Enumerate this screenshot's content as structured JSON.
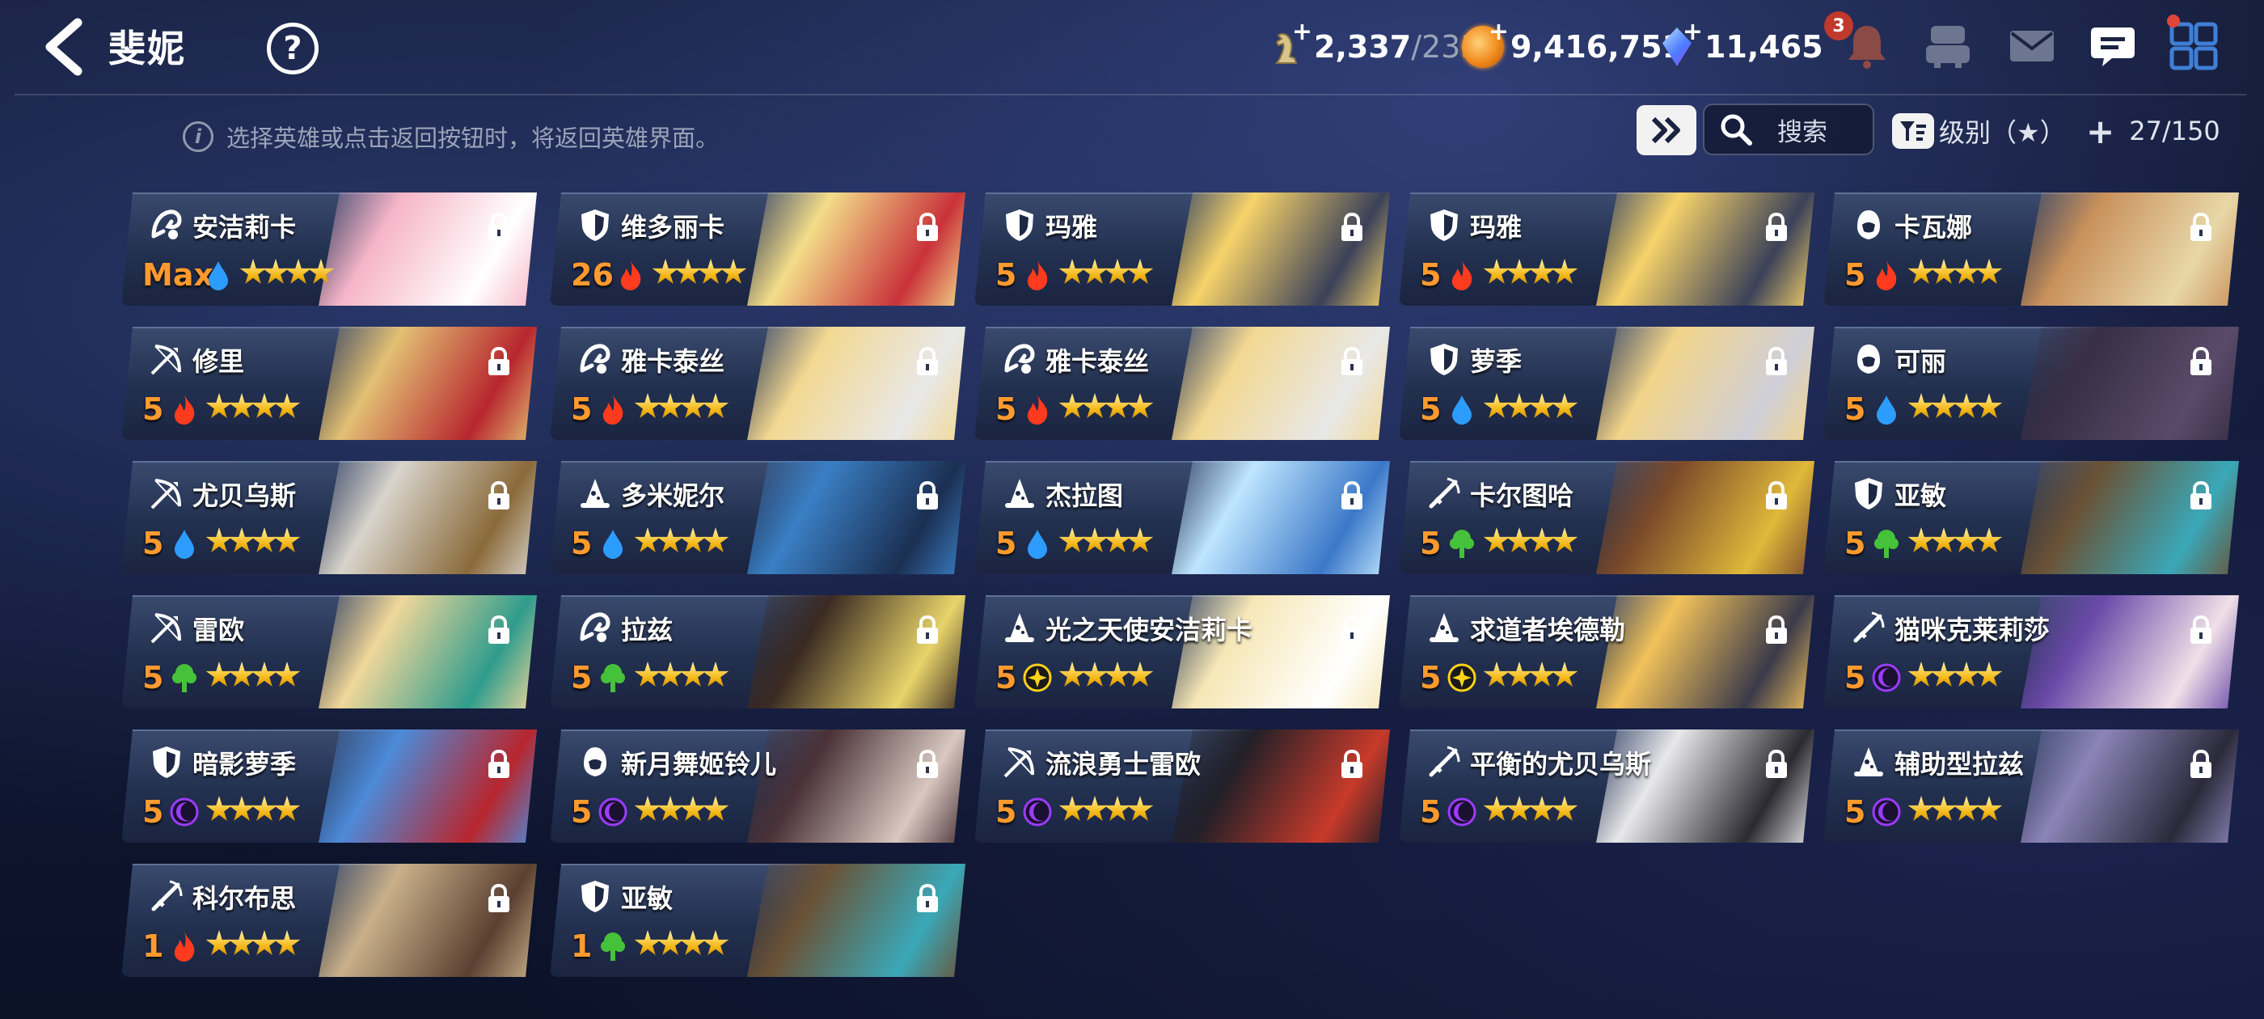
{
  "header": {
    "title": "斐妮",
    "resources": {
      "stamina": {
        "value": "2,337",
        "max": "/233"
      },
      "gold": {
        "value": "9,416,751"
      },
      "gems": {
        "value": "11,465"
      }
    },
    "bell_badge": "3"
  },
  "toolbar": {
    "hint": "选择英雄或点击返回按钮时，将返回英雄界面。",
    "search_label": "搜索",
    "sort_label": "级别（★）",
    "count": "27/150"
  },
  "colors": {
    "fire": "#ff3b1f",
    "water": "#2d9cff",
    "earth": "#46c23a",
    "light": "#ffd21a",
    "dark": "#9b3cff",
    "level": "#ff9a2e",
    "star": "#f5b818"
  },
  "heroes": [
    {
      "name": "安洁莉卡",
      "level": "Max",
      "element": "water",
      "class": "healer",
      "stars": 4,
      "portrait": [
        "#f6b5c9",
        "#ffffff"
      ]
    },
    {
      "name": "维多丽卡",
      "level": "26",
      "element": "fire",
      "class": "tank",
      "stars": 4,
      "portrait": [
        "#f3dd8a",
        "#c9323a"
      ]
    },
    {
      "name": "玛雅",
      "level": "5",
      "element": "fire",
      "class": "tank",
      "stars": 4,
      "portrait": [
        "#f7d36a",
        "#3b4158"
      ]
    },
    {
      "name": "玛雅",
      "level": "5",
      "element": "fire",
      "class": "tank",
      "stars": 4,
      "portrait": [
        "#f7d36a",
        "#3b4158"
      ]
    },
    {
      "name": "卡瓦娜",
      "level": "5",
      "element": "fire",
      "class": "assassin",
      "stars": 4,
      "portrait": [
        "#c9915c",
        "#e8d7a8"
      ]
    },
    {
      "name": "修里",
      "level": "5",
      "element": "fire",
      "class": "archer",
      "stars": 4,
      "portrait": [
        "#e2c074",
        "#b8262e"
      ]
    },
    {
      "name": "雅卡泰丝",
      "level": "5",
      "element": "fire",
      "class": "healer",
      "stars": 4,
      "portrait": [
        "#f3d892",
        "#e8e8e8"
      ]
    },
    {
      "name": "雅卡泰丝",
      "level": "5",
      "element": "fire",
      "class": "healer",
      "stars": 4,
      "portrait": [
        "#f3d892",
        "#e8e8e8"
      ]
    },
    {
      "name": "萝季",
      "level": "5",
      "element": "water",
      "class": "tank",
      "stars": 4,
      "portrait": [
        "#f2d48a",
        "#cfcfd8"
      ]
    },
    {
      "name": "可丽",
      "level": "5",
      "element": "water",
      "class": "assassin",
      "stars": 4,
      "portrait": [
        "#3a2f45",
        "#5a4a6a"
      ]
    },
    {
      "name": "尤贝乌斯",
      "level": "5",
      "element": "water",
      "class": "archer",
      "stars": 4,
      "portrait": [
        "#d8d4cc",
        "#8a6a3a"
      ]
    },
    {
      "name": "多米妮尔",
      "level": "5",
      "element": "water",
      "class": "mage",
      "stars": 4,
      "portrait": [
        "#3a7fc4",
        "#1b2f52"
      ]
    },
    {
      "name": "杰拉图",
      "level": "5",
      "element": "water",
      "class": "mage",
      "stars": 4,
      "portrait": [
        "#bfe6ff",
        "#3b78c8"
      ]
    },
    {
      "name": "卡尔图哈",
      "level": "5",
      "element": "earth",
      "class": "warrior",
      "stars": 4,
      "portrait": [
        "#7a4a2a",
        "#e0b83a"
      ]
    },
    {
      "name": "亚敏",
      "level": "5",
      "element": "earth",
      "class": "tank",
      "stars": 4,
      "portrait": [
        "#6a5236",
        "#3aa8b8"
      ]
    },
    {
      "name": "雷欧",
      "level": "5",
      "element": "earth",
      "class": "archer",
      "stars": 4,
      "portrait": [
        "#f0d79a",
        "#2f9c8c"
      ]
    },
    {
      "name": "拉兹",
      "level": "5",
      "element": "earth",
      "class": "healer",
      "stars": 4,
      "portrait": [
        "#3a2a22",
        "#e8d46a"
      ]
    },
    {
      "name": "光之天使安洁莉卡",
      "level": "5",
      "element": "light",
      "class": "mage",
      "stars": 4,
      "portrait": [
        "#f6e7b6",
        "#ffffff"
      ]
    },
    {
      "name": "求道者埃德勒",
      "level": "5",
      "element": "light",
      "class": "mage",
      "stars": 4,
      "portrait": [
        "#f2c25a",
        "#3b3a4a"
      ]
    },
    {
      "name": "猫咪克莱莉莎",
      "level": "5",
      "element": "dark",
      "class": "warrior",
      "stars": 4,
      "portrait": [
        "#6a4aa8",
        "#f0e0e8"
      ]
    },
    {
      "name": "暗影萝季",
      "level": "5",
      "element": "dark",
      "class": "tank",
      "stars": 4,
      "portrait": [
        "#4d8ad8",
        "#b8262e"
      ]
    },
    {
      "name": "新月舞姬铃儿",
      "level": "5",
      "element": "dark",
      "class": "assassin",
      "stars": 4,
      "portrait": [
        "#4a3238",
        "#d8c8c0"
      ]
    },
    {
      "name": "流浪勇士雷欧",
      "level": "5",
      "element": "dark",
      "class": "archer",
      "stars": 4,
      "portrait": [
        "#222028",
        "#c83a2a"
      ]
    },
    {
      "name": "平衡的尤贝乌斯",
      "level": "5",
      "element": "dark",
      "class": "warrior",
      "stars": 4,
      "portrait": [
        "#e8e8ea",
        "#2a2a30"
      ]
    },
    {
      "name": "辅助型拉兹",
      "level": "5",
      "element": "dark",
      "class": "mage",
      "stars": 4,
      "portrait": [
        "#8c84b8",
        "#2a2a3a"
      ]
    },
    {
      "name": "科尔布思",
      "level": "1",
      "element": "fire",
      "class": "warrior",
      "stars": 4,
      "portrait": [
        "#c9b08a",
        "#5a4030"
      ]
    },
    {
      "name": "亚敏",
      "level": "1",
      "element": "earth",
      "class": "tank",
      "stars": 4,
      "portrait": [
        "#6a5236",
        "#3aa8b8"
      ]
    }
  ]
}
